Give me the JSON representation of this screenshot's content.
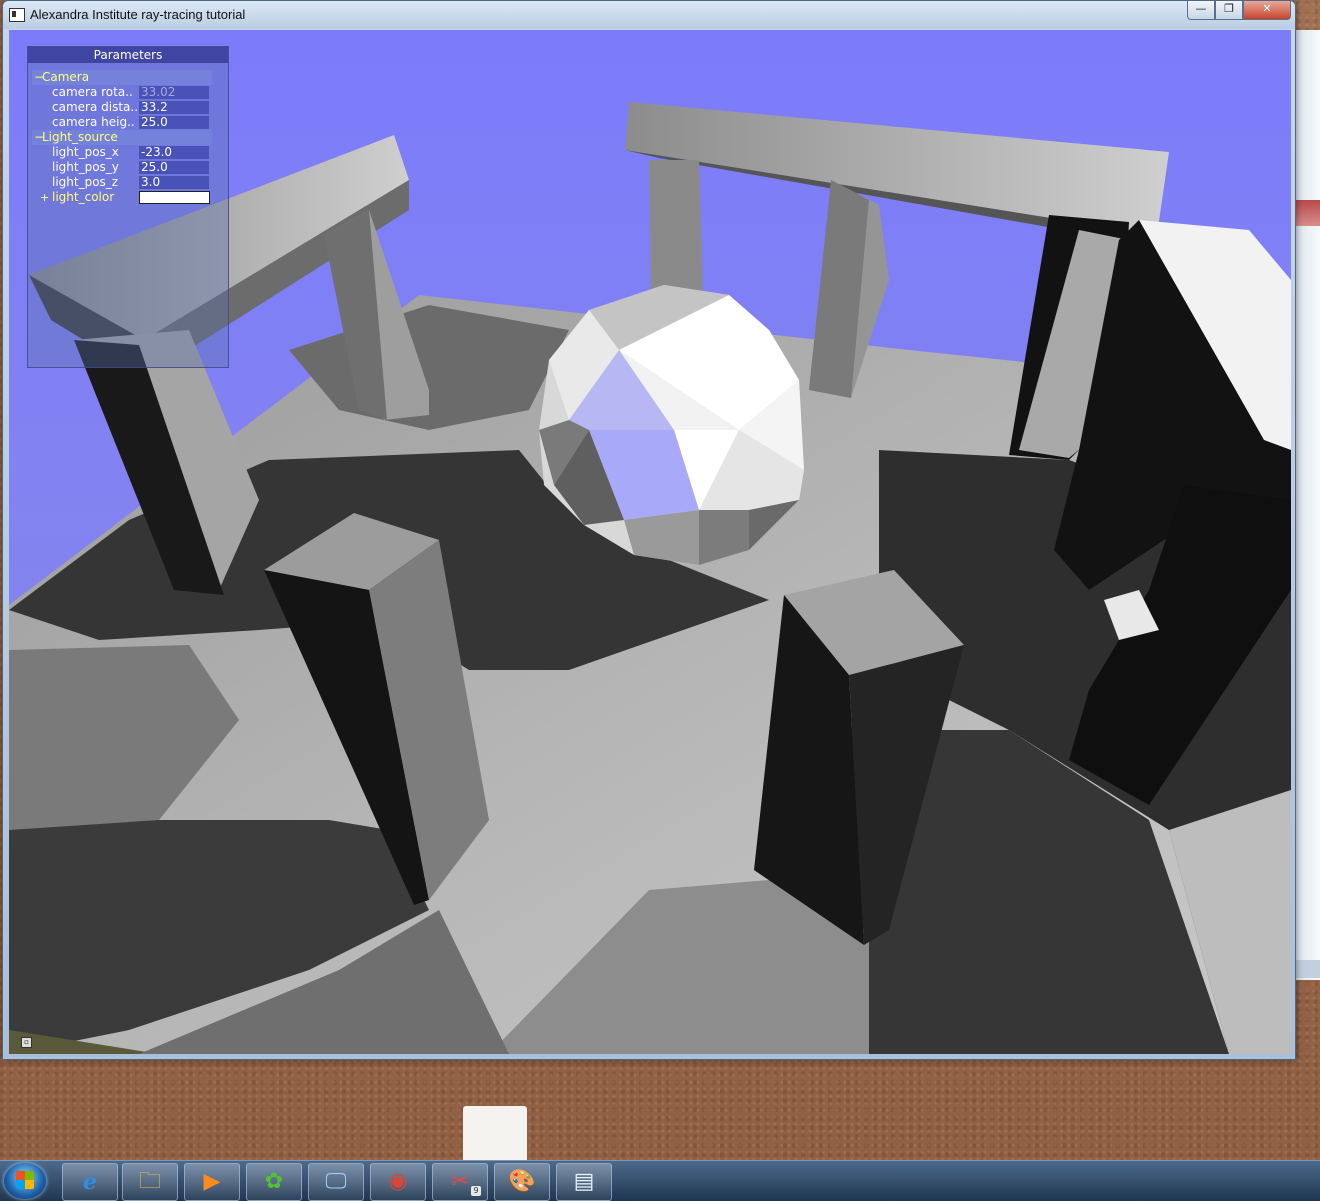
{
  "window": {
    "title": "Alexandra Institute ray-tracing tutorial",
    "min_symbol": "—",
    "max_symbol": "❐",
    "close_symbol": "✕"
  },
  "panel": {
    "title": "Parameters",
    "groups": [
      {
        "toggle": "−",
        "label": "Camera",
        "params": [
          {
            "label": "camera rota..",
            "value": "33.02",
            "disabled": true
          },
          {
            "label": "camera dista..",
            "value": "33.2"
          },
          {
            "label": "camera heig..",
            "value": "25.0"
          }
        ]
      },
      {
        "toggle": "−",
        "label": "Light_source",
        "params": [
          {
            "label": "light_pos_x",
            "value": "-23.0"
          },
          {
            "label": "light_pos_y",
            "value": "25.0"
          },
          {
            "label": "light_pos_z",
            "value": "3.0"
          },
          {
            "label": "light_color",
            "toggle": "+",
            "swatch": "#ffffff"
          }
        ]
      }
    ]
  },
  "scene": {
    "sky_color": "#7d7dfa",
    "floor_light": "#bcbcbc",
    "floor_mid": "#8e8e8e",
    "shadow": "#3a3a3a"
  },
  "taskbar": {
    "items": [
      {
        "name": "internet-explorer-icon",
        "glyph": "e"
      },
      {
        "name": "file-explorer-icon",
        "glyph": "🗀"
      },
      {
        "name": "media-player-icon",
        "glyph": "▶"
      },
      {
        "name": "icq-icon",
        "glyph": "✿"
      },
      {
        "name": "system-monitor-icon",
        "glyph": "🖵"
      },
      {
        "name": "chrome-icon",
        "glyph": "◉"
      },
      {
        "name": "tools-icon",
        "glyph": "✂",
        "badge": "9"
      },
      {
        "name": "paint-icon",
        "glyph": "🎨"
      },
      {
        "name": "app-window-icon",
        "glyph": "▤"
      }
    ]
  }
}
